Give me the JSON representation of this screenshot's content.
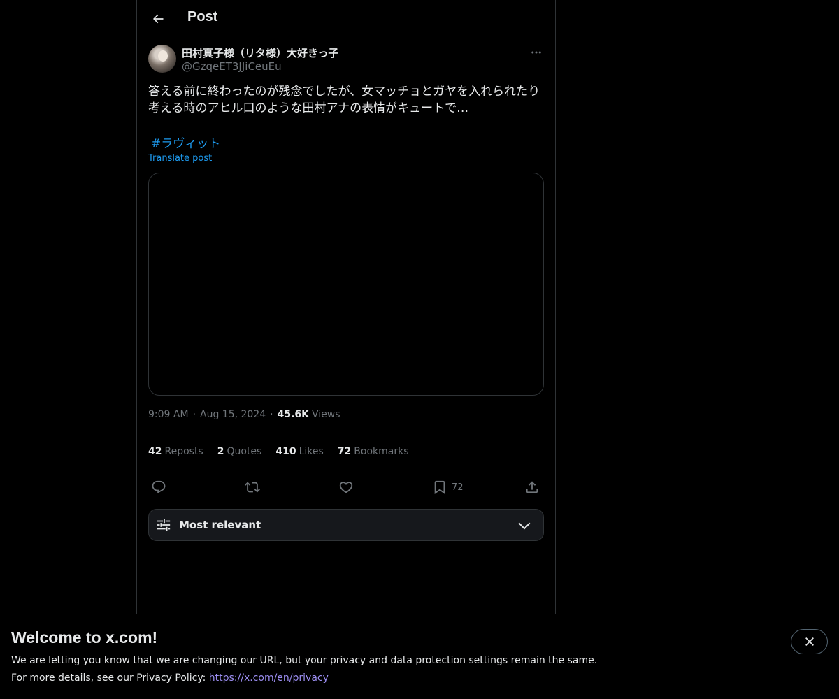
{
  "header": {
    "title": "Post"
  },
  "post": {
    "author": {
      "display_name": "田村真子様（リタ様）大好きっ子",
      "handle": "@GzqeET3JJiCeuEu"
    },
    "text": "答える前に終わったのが残念でしたが、女マッチョとガヤを入れられたり\n考える時のアヒル口のような田村アナの表情がキュートで…",
    "hashtag": "#ラヴィット",
    "translate_label": "Translate post",
    "meta": {
      "time": "9:09 AM",
      "date": "Aug 15, 2024",
      "views_count": "45.6K",
      "views_label": "Views"
    },
    "stats": {
      "reposts_count": "42",
      "reposts_label": "Reposts",
      "quotes_count": "2",
      "quotes_label": "Quotes",
      "likes_count": "410",
      "likes_label": "Likes",
      "bookmarks_count": "72",
      "bookmarks_label": "Bookmarks"
    },
    "actions": {
      "bookmark_count": "72"
    }
  },
  "sort": {
    "label": "Most relevant"
  },
  "banner": {
    "title": "Welcome to x.com!",
    "line1": "We are letting you know that we are changing our URL, but your privacy and data protection settings remain the same.",
    "line2_prefix": "For more details, see our Privacy Policy: ",
    "link": "https://x.com/en/privacy"
  },
  "colors": {
    "background": "#000000",
    "accent": "#1d9bf0",
    "muted": "#71767b",
    "border": "#2f3336"
  }
}
